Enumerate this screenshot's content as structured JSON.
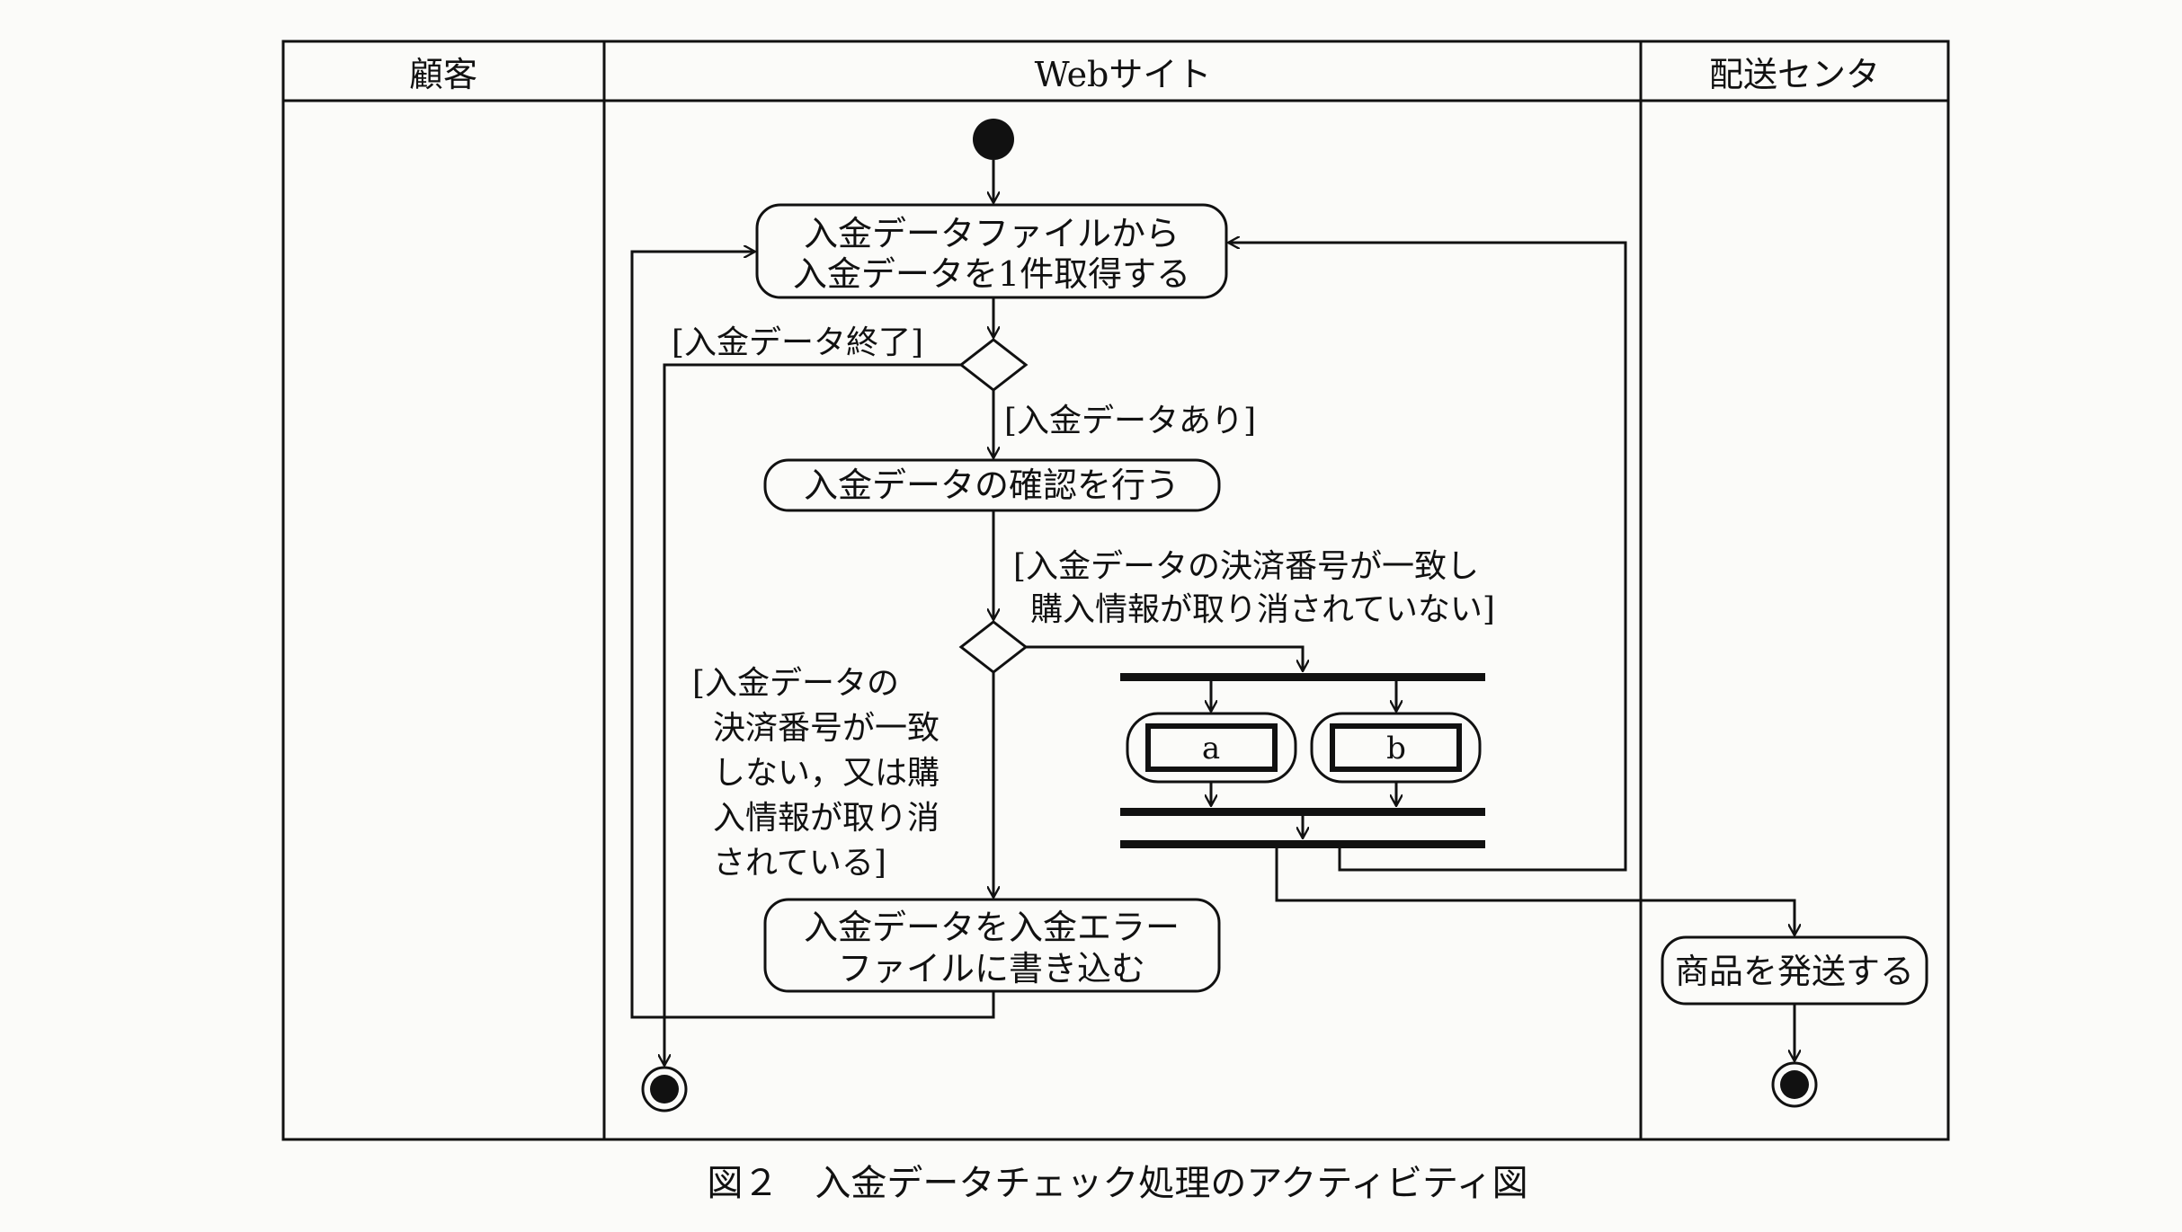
{
  "lanes": {
    "customer": "顧客",
    "website": "Webサイト",
    "delivery": "配送センタ"
  },
  "actions": {
    "get_data": [
      "入金データファイルから",
      "入金データを1件取得する"
    ],
    "check_data": "入金データの確認を行う",
    "write_error": [
      "入金データを入金エラー",
      "ファイルに書き込む"
    ],
    "ship": "商品を発送する",
    "blank_a": "a",
    "blank_b": "b"
  },
  "guards": {
    "end": "[入金データ終了]",
    "has_data": "[入金データあり]",
    "match": [
      "[入金データの決済番号が一致し",
      "購入情報が取り消されていない]"
    ],
    "mismatch": [
      "[入金データの",
      "決済番号が一致",
      "しない，又は購",
      "入情報が取り消",
      "されている]"
    ]
  },
  "caption": "図２　入金データチェック処理のアクティビティ図"
}
